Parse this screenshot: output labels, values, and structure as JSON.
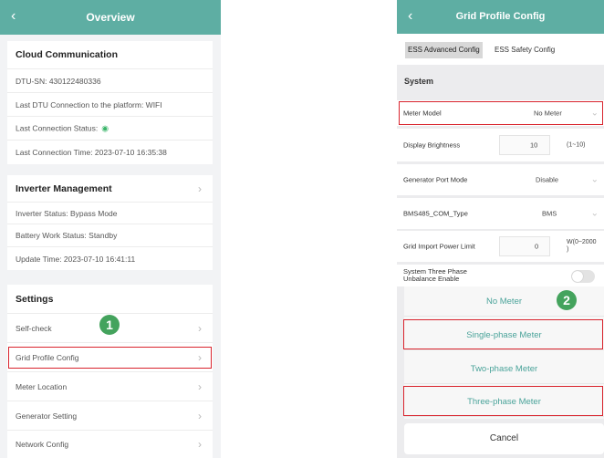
{
  "left": {
    "header": {
      "back_icon": "chevron-left-icon",
      "title": "Overview"
    },
    "cloud": {
      "title": "Cloud Communication",
      "dtu_sn": "DTU-SN: 430122480336",
      "last_connection": "Last DTU Connection to the platform: WIFI",
      "last_status_label": "Last Connection Status:",
      "last_status_icon": "wifi-icon",
      "last_time": "Last Connection Time: 2023-07-10 16:35:38"
    },
    "inverter": {
      "title": "Inverter Management",
      "status": "Inverter Status: Bypass Mode",
      "battery": "Battery Work Status: Standby",
      "update": "Update Time: 2023-07-10 16:41:11"
    },
    "settings": {
      "title": "Settings",
      "items": [
        "Self-check",
        "Grid Profile Config",
        "Meter Location",
        "Generator Setting",
        "Network Config"
      ]
    },
    "badge": "1"
  },
  "right": {
    "header": {
      "back_icon": "chevron-left-icon",
      "title": "Grid Profile Config"
    },
    "tabs": [
      "ESS Advanced Config",
      "ESS Safety Config"
    ],
    "section": "System",
    "rows": {
      "meter_model": {
        "label": "Meter Model",
        "value": "No Meter"
      },
      "display_brightness": {
        "label": "Display Brightness",
        "value": "10",
        "unit": "(1~10)"
      },
      "generator_port": {
        "label": "Generator Port Mode",
        "value": "Disable"
      },
      "bms485": {
        "label": "BMS485_COM_Type",
        "value": "BMS"
      },
      "grid_import": {
        "label": "Grid Import Power Limit",
        "value": "0",
        "unit_line1": "W(0~2000",
        "unit_line2": ")"
      },
      "three_phase": {
        "label_line1": "System Three Phase",
        "label_line2": "Unbalance Enable",
        "enabled": false
      }
    },
    "sheet": {
      "options": [
        "No Meter",
        "Single-phase Meter",
        "Two-phase Meter",
        "Three-phase Meter"
      ],
      "cancel": "Cancel"
    },
    "badge": "2"
  },
  "colors": {
    "header": "#5eaea3",
    "highlight": "#d9232d",
    "badge": "#44a35d",
    "option_text": "#4aa39a"
  }
}
